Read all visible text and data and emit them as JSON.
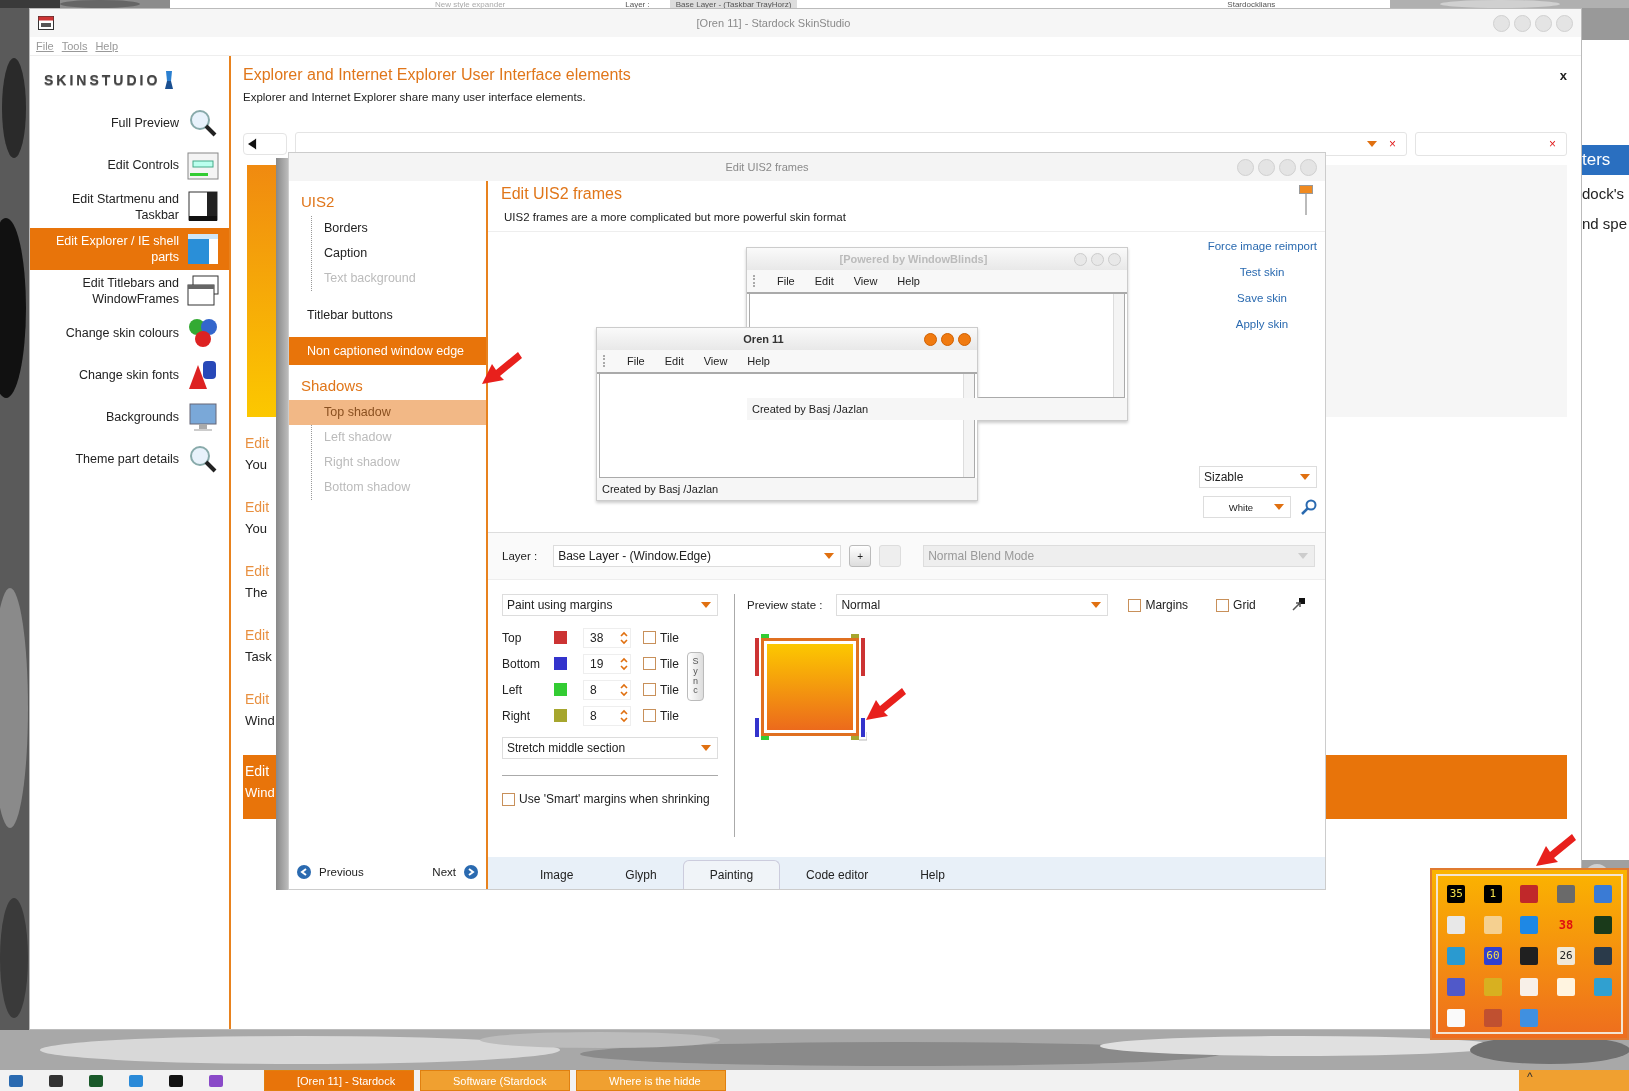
{
  "background_strip": {
    "texts": [
      "New style expander",
      "Layer :",
      "Base Layer - (Taskbar TrayHorz)",
      "Stardocklians"
    ]
  },
  "side_window": {
    "header": "ters",
    "lines": [
      "dock's",
      "nd spe"
    ]
  },
  "window": {
    "title": "[Oren 11] - Stardock SkinStudio",
    "menu": [
      "File",
      "Tools",
      "Help"
    ],
    "logo": "SKINSTUDIO"
  },
  "sidebar": {
    "items": [
      {
        "label": "Full Preview",
        "selected": false
      },
      {
        "label": "Edit Controls",
        "selected": false
      },
      {
        "label": "Edit Startmenu and Taskbar",
        "selected": false
      },
      {
        "label": "Edit Explorer / IE shell parts",
        "selected": true
      },
      {
        "label": "Edit Titlebars and WindowFrames",
        "selected": false
      },
      {
        "label": "Change skin colours",
        "selected": false
      },
      {
        "label": "Change skin fonts",
        "selected": false
      },
      {
        "label": "Backgrounds",
        "selected": false
      },
      {
        "label": "Theme part details",
        "selected": false
      }
    ]
  },
  "content": {
    "title": "Explorer and Internet Explorer User Interface elements",
    "description": "Explorer and Internet Explorer share many user interface elements.",
    "close": "x",
    "filter_clear": [
      "×",
      "×"
    ],
    "sections": [
      {
        "title": "Edit",
        "text": "You",
        "selected": false
      },
      {
        "title": "Edit",
        "text": "You",
        "selected": false
      },
      {
        "title": "Edit",
        "text": "The",
        "selected": false
      },
      {
        "title": "Edit",
        "text": "Task",
        "selected": false
      },
      {
        "title": "Edit",
        "text": "Wind",
        "selected": false
      },
      {
        "title": "Edit",
        "text": "Wind",
        "selected": true
      }
    ]
  },
  "dialog": {
    "title": "Edit UIS2 frames",
    "tree": [
      {
        "kind": "group",
        "label": "UIS2",
        "children": [
          {
            "label": "Borders",
            "selected": false,
            "disabled": false,
            "hovered": false
          },
          {
            "label": "Caption",
            "selected": false,
            "disabled": false,
            "hovered": false
          },
          {
            "label": "Text background",
            "selected": false,
            "disabled": true,
            "hovered": false
          }
        ]
      },
      {
        "kind": "item",
        "label": "Titlebar buttons",
        "selected": false
      },
      {
        "kind": "item",
        "label": "Non captioned window edge",
        "selected": true
      },
      {
        "kind": "group",
        "label": "Shadows",
        "children": [
          {
            "label": "Top shadow",
            "selected": false,
            "disabled": true,
            "hovered": true
          },
          {
            "label": "Left shadow",
            "selected": false,
            "disabled": true,
            "hovered": false
          },
          {
            "label": "Right shadow",
            "selected": false,
            "disabled": true,
            "hovered": false
          },
          {
            "label": "Bottom shadow",
            "selected": false,
            "disabled": true,
            "hovered": false
          }
        ]
      }
    ],
    "nav": {
      "previous": "Previous",
      "next": "Next"
    },
    "heading": "Edit UIS2 frames",
    "description": "UIS2 frames are a more complicated but more powerful skin format",
    "preview_windows": [
      {
        "title": "[Powered by WindowBlinds]",
        "active": false,
        "menu": [
          "File",
          "Edit",
          "View",
          "Help"
        ],
        "status": "Created by Basj /Jazlan"
      },
      {
        "title": "Oren 11",
        "active": true,
        "menu": [
          "File",
          "Edit",
          "View",
          "Help"
        ],
        "status": "Created by Basj /Jazlan"
      }
    ],
    "links": [
      "Force image reimport",
      "Test skin",
      "Save skin",
      "Apply skin"
    ],
    "frame_mode": "Sizable",
    "background": "White",
    "layer": {
      "label": "Layer :",
      "value": "Base Layer - (Window.Edge)",
      "add": "+",
      "blend": "Normal Blend Mode",
      "blend_disabled": true
    },
    "paint_mode": "Paint using margins",
    "margins": [
      {
        "label": "Top",
        "color": "#cc3333",
        "value": "38",
        "tile": false,
        "tile_label": "Tile"
      },
      {
        "label": "Bottom",
        "color": "#3333cc",
        "value": "19",
        "tile": false,
        "tile_label": "Tile"
      },
      {
        "label": "Left",
        "color": "#33cc33",
        "value": "8",
        "tile": false,
        "tile_label": "Tile"
      },
      {
        "label": "Right",
        "color": "#a6a62e",
        "value": "8",
        "tile": false,
        "tile_label": "Tile"
      }
    ],
    "sync": "Sync",
    "middle": "Stretch middle section",
    "smart_margins": {
      "label": "Use 'Smart' margins when shrinking",
      "checked": false
    },
    "preview_state": {
      "label": "Preview state :",
      "value": "Normal"
    },
    "options": [
      {
        "label": "Margins",
        "checked": false
      },
      {
        "label": "Grid",
        "checked": false
      }
    ],
    "tabs": [
      {
        "label": "Image",
        "selected": false
      },
      {
        "label": "Glyph",
        "selected": false
      },
      {
        "label": "Painting",
        "selected": true
      },
      {
        "label": "Code editor",
        "selected": false
      },
      {
        "label": "Help",
        "selected": false
      }
    ]
  },
  "tray_popup": {
    "icons": [
      {
        "kind": "tile",
        "label": "35",
        "color": "#000000"
      },
      {
        "kind": "tile",
        "label": "1",
        "color": "#000000"
      },
      {
        "kind": "tile",
        "color": "#c0282a"
      },
      {
        "kind": "tile",
        "color": "#6a6a6a"
      },
      {
        "kind": "tile",
        "color": "#3a7bd5"
      },
      {
        "kind": "tile",
        "color": "#e8e8e8"
      },
      {
        "kind": "tile",
        "color": "#f5d090"
      },
      {
        "kind": "tile",
        "color": "#1e88e5"
      },
      {
        "kind": "text",
        "label": "38",
        "color": "#e01010"
      },
      {
        "kind": "tile",
        "color": "#1a3a1a"
      },
      {
        "kind": "tile",
        "color": "#2a9ad0"
      },
      {
        "kind": "tile",
        "label": "60",
        "color": "#3040d0"
      },
      {
        "kind": "tile",
        "color": "#202020"
      },
      {
        "kind": "tile",
        "label": "26",
        "color": "#f0e8d8"
      },
      {
        "kind": "tile",
        "color": "#2a3a4a"
      },
      {
        "kind": "tile",
        "color": "#5059c9"
      },
      {
        "kind": "tile",
        "color": "#d8b020"
      },
      {
        "kind": "tile",
        "color": "#f8f0e8"
      },
      {
        "kind": "tile",
        "color": "#fff4e0"
      },
      {
        "kind": "tile",
        "color": "#30a0d0"
      },
      {
        "kind": "tile",
        "color": "#fafafa"
      },
      {
        "kind": "tile",
        "color": "#c05030"
      },
      {
        "kind": "tile",
        "color": "#4090e0"
      }
    ]
  },
  "taskbar": {
    "buttons": [
      {
        "label": "[Oren 11] - Stardock",
        "selected": true
      },
      {
        "label": "Software (Stardock",
        "selected": false
      },
      {
        "label": "Where is the hidde",
        "selected": false
      }
    ],
    "tray_chevron": "^"
  }
}
